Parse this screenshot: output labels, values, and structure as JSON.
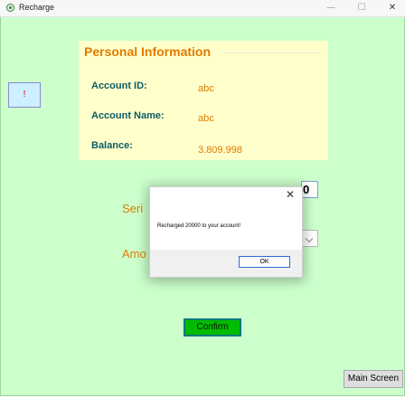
{
  "window": {
    "title": "Recharge",
    "minimize": "—",
    "maximize": "☐",
    "close": "✕"
  },
  "info": {
    "title": "Personal Information",
    "account_id_label": "Account ID:",
    "account_id_value": "abc",
    "account_name_label": "Account Name:",
    "account_name_value": "abc",
    "balance_label": "Balance:",
    "balance_value": "3.809.998"
  },
  "warning_button": {
    "label": "!"
  },
  "form": {
    "serial_label_partial": "Seri",
    "serial_value_partial": "0",
    "amount_label_partial": "Amo"
  },
  "buttons": {
    "confirm": "Confirm",
    "main_screen": "Main Screen"
  },
  "dialog": {
    "close": "✕",
    "message": "Recharged 20000 to your account!",
    "ok": "OK"
  },
  "colors": {
    "client_background": "#ccffcc",
    "panel_background": "#ffffcc",
    "title_orange": "#e07b00",
    "label_teal": "#0b5e66",
    "confirm_green": "#00bb00"
  }
}
